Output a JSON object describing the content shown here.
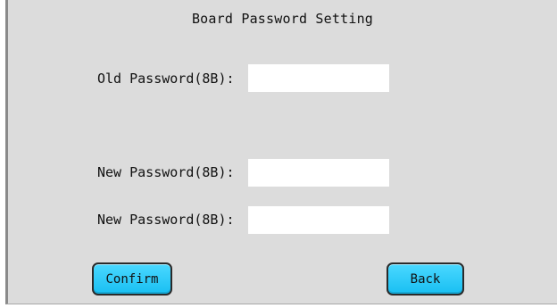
{
  "window": {
    "title": "Board Password Setting"
  },
  "form": {
    "old_password": {
      "label": "Old Password(8B):",
      "value": "",
      "placeholder": ""
    },
    "new_password": {
      "label": "New Password(8B):",
      "value": "",
      "placeholder": ""
    },
    "confirm_password": {
      "label": "New Password(8B):",
      "value": "",
      "placeholder": ""
    }
  },
  "buttons": {
    "confirm_label": "Confirm",
    "back_label": "Back"
  },
  "colors": {
    "panel_background": "#dcdcdc",
    "button_accent": "#19bff2",
    "field_background": "#ffffff"
  }
}
